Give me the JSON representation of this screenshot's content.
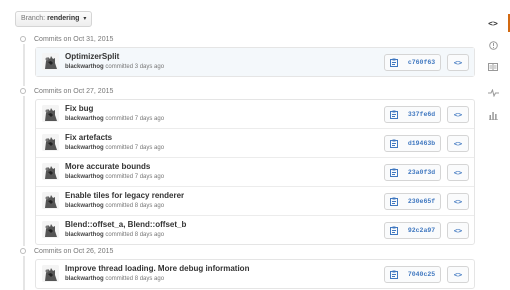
{
  "branch": {
    "prefix": "Branch:",
    "name": "rendering"
  },
  "sidebar": {
    "items": [
      {
        "icon": "code-icon",
        "active": true
      },
      {
        "icon": "issue-icon",
        "active": false
      },
      {
        "icon": "book-icon",
        "active": false
      },
      {
        "icon": "pulse-icon",
        "active": false
      },
      {
        "icon": "graph-icon",
        "active": false
      }
    ]
  },
  "days": [
    {
      "header": "Commits on Oct 31, 2015",
      "commits": [
        {
          "title": "OptimizerSplit",
          "author": "blackwarthog",
          "when": "committed 3 days ago",
          "sha": "c760f63",
          "highlight": true
        }
      ]
    },
    {
      "header": "Commits on Oct 27, 2015",
      "commits": [
        {
          "title": "Fix bug",
          "author": "blackwarthog",
          "when": "committed 7 days ago",
          "sha": "337fe6d"
        },
        {
          "title": "Fix artefacts",
          "author": "blackwarthog",
          "when": "committed 7 days ago",
          "sha": "d19463b"
        },
        {
          "title": "More accurate bounds",
          "author": "blackwarthog",
          "when": "committed 7 days ago",
          "sha": "23a0f3d"
        },
        {
          "title": "Enable tiles for legacy renderer",
          "author": "blackwarthog",
          "when": "committed 8 days ago",
          "sha": "230e65f"
        },
        {
          "title": "Blend::offset_a, Blend::offset_b",
          "author": "blackwarthog",
          "when": "committed 8 days ago",
          "sha": "92c2a97"
        }
      ]
    },
    {
      "header": "Commits on Oct 26, 2015",
      "commits": [
        {
          "title": "Improve thread loading. More debug information",
          "author": "blackwarthog",
          "when": "committed 8 days ago",
          "sha": "7040c25"
        }
      ]
    }
  ],
  "colors": {
    "accent": "#d26911",
    "sha": "#4078c0"
  }
}
